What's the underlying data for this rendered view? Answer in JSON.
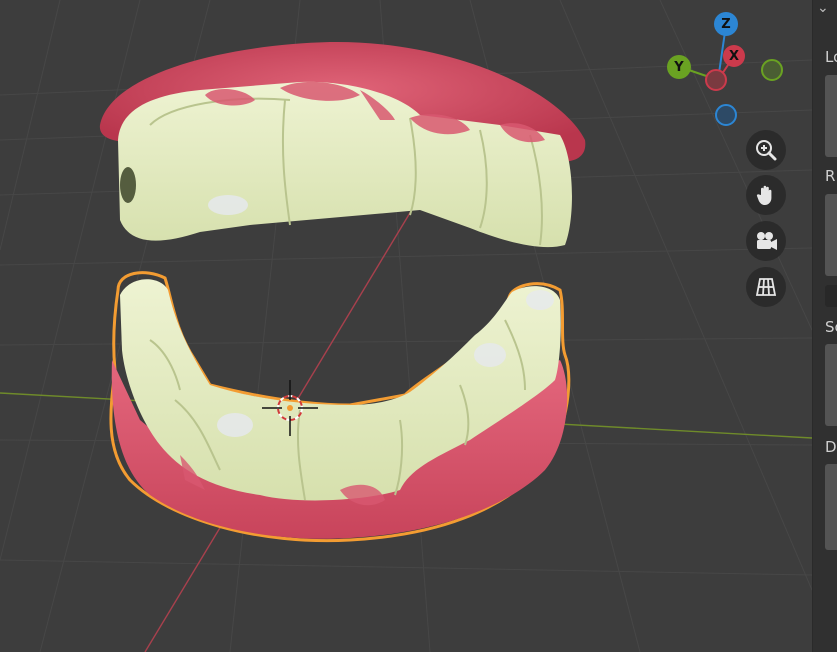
{
  "app": "Blender",
  "viewport": {
    "scene_object": "denture model (upper and lower teeth)",
    "selected_object": "lower jaw"
  },
  "gizmo": {
    "z_label": "Z",
    "y_label": "Y",
    "x_label": "X",
    "colors": {
      "z": "#2c86d4",
      "y": "#6aa222",
      "x": "#cc3a4c"
    }
  },
  "nav_buttons": [
    "zoom-icon",
    "pan-hand-icon",
    "camera-icon",
    "ortho-grid-icon"
  ],
  "n_panel": {
    "chevron": "⌄",
    "sections": [
      {
        "label": "Lo"
      },
      {
        "label": "R"
      },
      {
        "label": "Sc"
      },
      {
        "label": "D"
      }
    ]
  }
}
